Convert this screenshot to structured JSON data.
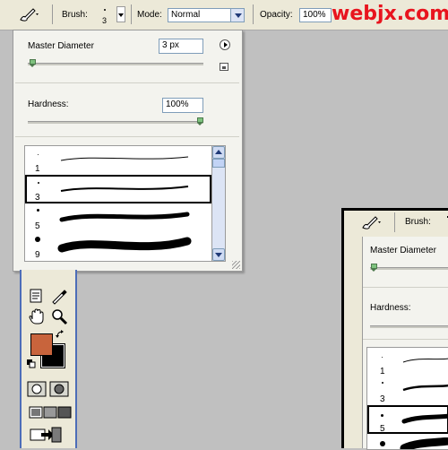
{
  "options_bar": {
    "tool_icon": "brush-icon",
    "brush_label": "Brush:",
    "brush_size_value": "3",
    "mode_label": "Mode:",
    "mode_value": "Normal",
    "opacity_label": "Opacity:",
    "opacity_value": "100%"
  },
  "watermark": "webjx.com",
  "brush_panel": {
    "master_diameter_label": "Master Diameter",
    "master_diameter_value": "3 px",
    "master_diameter_level": 0.01,
    "hardness_label": "Hardness:",
    "hardness_value": "100%",
    "hardness_level": 1.0,
    "brushes": [
      {
        "size": "1",
        "selected": false
      },
      {
        "size": "3",
        "selected": true
      },
      {
        "size": "5",
        "selected": false
      },
      {
        "size": "9",
        "selected": false
      }
    ]
  },
  "toolbox": {
    "foreground_color": "#c8643c",
    "background_color": "#000000",
    "tools": [
      "notes-icon",
      "eyedropper-icon",
      "hand-icon",
      "zoom-icon",
      "standard-mode-icon",
      "quick-mask-icon",
      "screen-mode-icon",
      "jump-to-imageready-icon"
    ]
  },
  "second_window": {
    "brush_label": "Brush:",
    "master_diameter_label": "Master Diameter",
    "hardness_label": "Hardness:",
    "brushes": [
      {
        "size": "1",
        "selected": false
      },
      {
        "size": "3",
        "selected": false
      },
      {
        "size": "5",
        "selected": true
      }
    ]
  }
}
